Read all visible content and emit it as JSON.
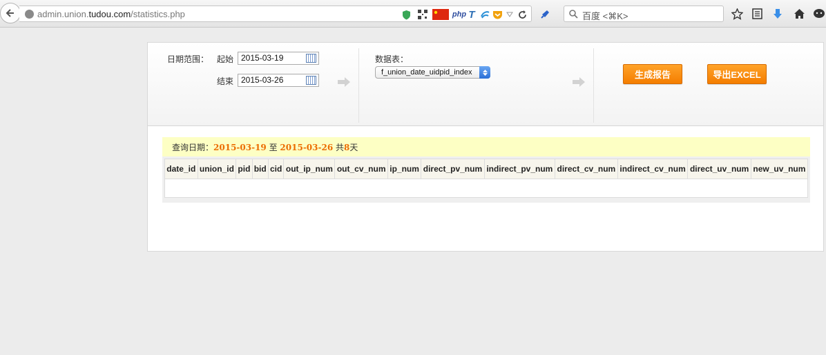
{
  "browser": {
    "url_prefix": "admin.union.",
    "url_domain": "tudou.com",
    "url_path": "/statistics.php",
    "search_placeholder": "百度 <⌘K>",
    "php_addon": "php"
  },
  "form": {
    "date_range_label": "日期范围：",
    "start_label": "起始",
    "start_value": "2015-03-19",
    "end_label": "结束",
    "end_value": "2015-03-26",
    "table_label": "数据表：",
    "table_selected": "f_union_date_uidpid_index",
    "generate_button": "生成报告",
    "export_button": "导出EXCEL"
  },
  "summary": {
    "prefix": "查询日期：",
    "start": "2015-03-19",
    "to": " 至 ",
    "end": "2015-03-26",
    "total_prefix": " 共",
    "days": "8",
    "days_suffix": "天"
  },
  "table": {
    "columns": [
      "date_id",
      "union_id",
      "pid",
      "bid",
      "cid",
      "out_ip_num",
      "out_cv_num",
      "ip_num",
      "direct_pv_num",
      "indirect_pv_num",
      "direct_cv_num",
      "indirect_cv_num",
      "direct_uv_num",
      "new_uv_num"
    ]
  },
  "colors": {
    "accent_orange": "#f47d00",
    "highlight_text": "#ec6c00",
    "summary_bg": "#fdffc4"
  }
}
